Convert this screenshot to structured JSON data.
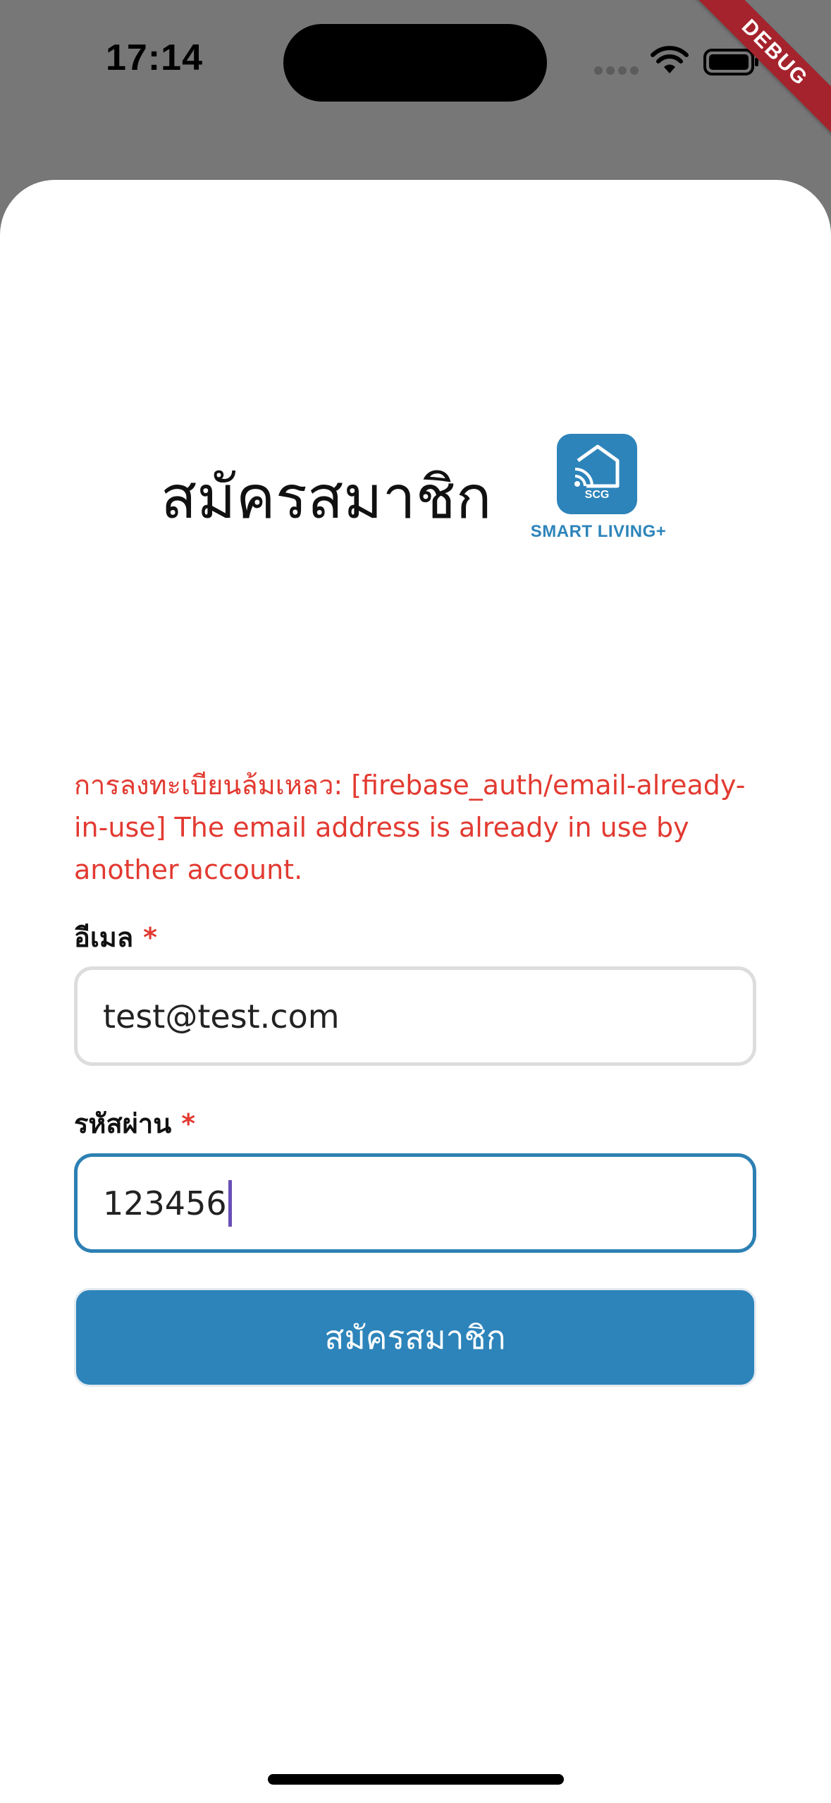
{
  "status_bar": {
    "time": "17:14"
  },
  "debug_banner": "DEBUG",
  "header": {
    "title": "สมัครสมาชิก",
    "logo": {
      "tile_text": "SCG",
      "brand_text": "SMART LIVING+",
      "icon": "smart-home-icon"
    }
  },
  "error_message": "การลงทะเบียนล้มเหลว: [firebase_auth/email-already-in-use] The email address is already in use by another account.",
  "form": {
    "email": {
      "label": "อีเมล",
      "required_mark": "*",
      "value": "test@test.com"
    },
    "password": {
      "label": "รหัสผ่าน",
      "required_mark": "*",
      "value": "123456"
    },
    "submit_label": "สมัครสมาชิก"
  },
  "colors": {
    "accent": "#2d84ba",
    "error": "#e23a31",
    "overlay": "#777777"
  }
}
